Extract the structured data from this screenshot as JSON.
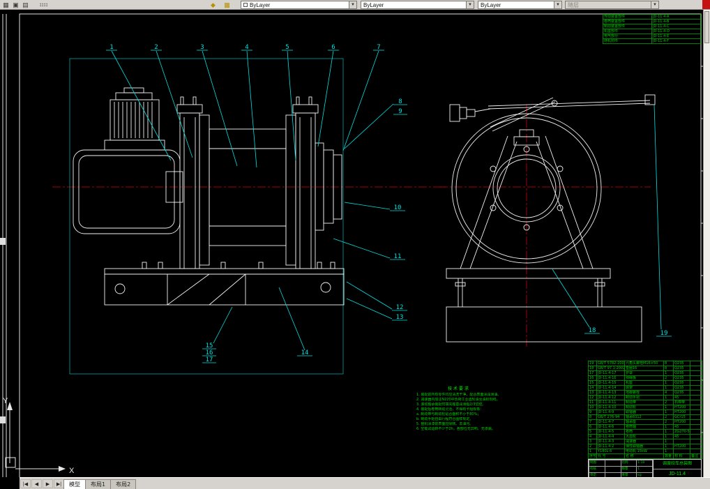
{
  "toolbar": {
    "icon_glyphs": {
      "g1": "▦",
      "g2": "▣",
      "g3": "▤",
      "g4": "↕↕↕↕",
      "g5": "◆",
      "g6": "▩"
    },
    "color": "ByLayer",
    "linetype": "ByLayer",
    "lineweight": "ByLayer",
    "plot_style": "随层"
  },
  "drawing": {
    "callouts": [
      "1",
      "2",
      "3",
      "4",
      "5",
      "6",
      "7",
      "8",
      "9",
      "10",
      "11",
      "12",
      "13",
      "14",
      "15",
      "16",
      "17",
      "18",
      "19"
    ],
    "ucs": {
      "x": "X",
      "y": "Y"
    },
    "colors": {
      "lines": "#f2f2f2",
      "centerline": "#d40000",
      "leaders": "#00e0e0",
      "annotations": "#00cc00"
    }
  },
  "notes": {
    "title": "技 术 要 求",
    "lines": [
      "1. 装配前所有零件均应清洗干净，配合表面涂润滑油。",
      "2. 减速器内加注N220中负荷工业齿轮油至油标刻线。",
      "3. 滚动轴承装配时填充锂基润滑脂2/3空腔。",
      "4. 装配后卷筒转动灵活，不得有卡阻现象：",
      "   a. 制动带与制动轮贴合面积不小于80%；",
      "   b. 制动手把自由行程符合图样规定。",
      "5. 整机涂漆前表面应除锈、去油污。",
      "6. 空载试运转不少于2h，各部位无异响、无渗漏。"
    ]
  },
  "parts_table": {
    "headers": [
      "序号",
      "代  号",
      "名  称",
      "数量",
      "材 料",
      "备注"
    ],
    "rows": [
      [
        "19",
        "GB/T 5782-2000",
        "六角头螺栓M16×50",
        "8",
        "Q235",
        ""
      ],
      [
        "18",
        "GB/T 97.1-2002",
        "垫圈16",
        "8",
        "Q235",
        ""
      ],
      [
        "17",
        "JD-11.4-17",
        "护罩",
        "1",
        "Q235",
        ""
      ],
      [
        "16",
        "JD-11.4-16",
        "挡绳板",
        "2",
        "Q235",
        ""
      ],
      [
        "15",
        "JD-11.4-15",
        "机座",
        "1",
        "Q235",
        ""
      ],
      [
        "14",
        "JD-11.4-14",
        "底架",
        "1",
        "Q235",
        ""
      ],
      [
        "13",
        "JD-11.4-13",
        "地脚螺栓",
        "4",
        "Q235",
        ""
      ],
      [
        "12",
        "JD-11.4-12",
        "制动手把",
        "1",
        "45",
        ""
      ],
      [
        "11",
        "JD-11.4-11",
        "制动带",
        "2",
        "石棉带",
        ""
      ],
      [
        "10",
        "JD-11.4-10",
        "制动轮",
        "1",
        "HT200",
        ""
      ],
      [
        "9",
        "JD-11.4-9",
        "联轴器",
        "1",
        "HT200",
        ""
      ],
      [
        "8",
        "GB/T 276-94",
        "轴承6312",
        "2",
        "GCr15",
        ""
      ],
      [
        "7",
        "JD-11.4-7",
        "轴承座",
        "2",
        "HT200",
        ""
      ],
      [
        "6",
        "JD-11.4-6",
        "卷筒轴",
        "1",
        "45",
        ""
      ],
      [
        "5",
        "JD-11.4-5",
        "卷筒",
        "1",
        "ZG270-500",
        ""
      ],
      [
        "4",
        "JD-11.4-4",
        "大齿轮",
        "1",
        "45",
        ""
      ],
      [
        "3",
        "JD-11.4-3",
        "减速器",
        "1",
        "",
        ""
      ],
      [
        "2",
        "JD-11.4-2",
        "弹性联轴器",
        "1",
        "HT200",
        ""
      ],
      [
        "1",
        "Y180L-6",
        "电动机 15kW",
        "1",
        "",
        ""
      ]
    ]
  },
  "revision_table": {
    "rows": [
      [
        "传动装置部件",
        "JD-11.4-A"
      ],
      [
        "卷筒装置部件",
        "JD-11.4-B"
      ],
      [
        "制动装置部件",
        "JD-11.4-C"
      ],
      [
        "机座部件",
        "JD-11.4-D"
      ],
      [
        "电气部分",
        "JD-11.4-E"
      ],
      [
        "随机附件",
        "JD-11.4-F"
      ]
    ]
  },
  "title_block": {
    "grid": [
      [
        "制图",
        "",
        "比例",
        "1:10"
      ],
      [
        "校核",
        "",
        "数量",
        "1"
      ],
      [
        "审定",
        "",
        "重量",
        "kg"
      ]
    ],
    "name": "调度绞车总装图",
    "number": "JD-11.4"
  },
  "statusbar": {
    "nav": [
      "|◀",
      "◀",
      "▶",
      "▶|"
    ],
    "tabs": [
      "模型",
      "布局1",
      "布局2"
    ]
  }
}
